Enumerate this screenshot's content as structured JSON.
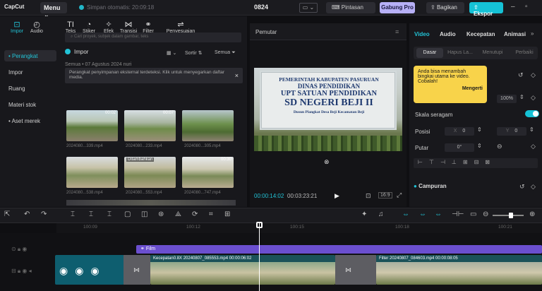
{
  "app": {
    "logo": "CapCut",
    "menu": "Menu",
    "autosave": "Simpan otomatis: 20:09:18",
    "project_name": "0824"
  },
  "topbar": {
    "shortcut_label": "Pintasan",
    "pro_label": "Gabung Pro",
    "share_label": "Bagikan",
    "export_label": "Ekspor"
  },
  "toolbar": {
    "tools": [
      "Impor",
      "Audio",
      "Teks",
      "Stiker",
      "Efek",
      "Transisi",
      "Filter",
      "Penyesuaian"
    ]
  },
  "sidebar": {
    "items": [
      "• Perangkat",
      "Impor",
      "Ruang",
      "Materi stok",
      "• Aset merek"
    ]
  },
  "media": {
    "search_placeholder": "Cari proyek, subjek dalam gambar, teks",
    "import_label": "Impor",
    "sort_label": "Sortir",
    "all_label": "Semua",
    "date_label": "Semua • 07 Agustus 2024 nuri",
    "notice": "Perangkat penyimpanan eksternal terdeteksi. Klik untuk menyegarkan daftar media.",
    "thumbs": [
      {
        "name": "2024080...339.mp4",
        "dur": "00:02",
        "badge": ""
      },
      {
        "name": "2024080...233.mp4",
        "dur": "00:07",
        "badge": ""
      },
      {
        "name": "2024080...305.mp4",
        "dur": "",
        "badge": ""
      },
      {
        "name": "2024080...538.mp4",
        "dur": "",
        "badge": ""
      },
      {
        "name": "2024080...553.mp4",
        "dur": "",
        "badge": "Ditambahkan"
      },
      {
        "name": "2024080...747.mp4",
        "dur": "00:30",
        "badge": ""
      }
    ]
  },
  "viewer": {
    "title": "Pemutar",
    "sign_lines": [
      "PEMERINTAH KABUPATEN PASURUAN",
      "DINAS PENDIDIKAN",
      "UPT SATUAN PENDIDIKAN",
      "SD NEGERI BEJI II",
      "Dusun Plangkat Desa Beji Kecamatan Beji"
    ],
    "time_current": "00:00:14:02",
    "time_total": "00:03:23:21",
    "ratio_label": "16:9"
  },
  "inspector": {
    "tabs": [
      "Video",
      "Audio",
      "Kecepatan",
      "Animasi"
    ],
    "subtabs": [
      "Dasar",
      "Hapus La...",
      "Menutupi",
      "Perbaiki"
    ],
    "tooltip_text": "Anda bisa menambah bingkai utama ke video. Cobalah!",
    "tooltip_button": "Mengerti",
    "scale_value": "100%",
    "uniform_scale_label": "Skala seragam",
    "position_label": "Posisi",
    "pos_x_label": "X",
    "pos_x": "0",
    "pos_y_label": "Y",
    "pos_y": "0",
    "rotate_label": "Putar",
    "rotate_value": "0°",
    "blend_label": "Campuran"
  },
  "timeline": {
    "ruler": [
      "100:09",
      "100:12",
      "100:15",
      "100:18",
      "100:21"
    ],
    "film_track": "Film",
    "clip1": "Kecepatan0.8X  20240807_085553.mp4  00:00:06:02",
    "clip2": "Filter  20240807_084603.mp4  00:00:08:05"
  },
  "colors": {
    "accent": "#15c2d6",
    "pro": "#b7b0f6",
    "film": "#6b4fcf",
    "tooltip": "#f8d34a"
  }
}
